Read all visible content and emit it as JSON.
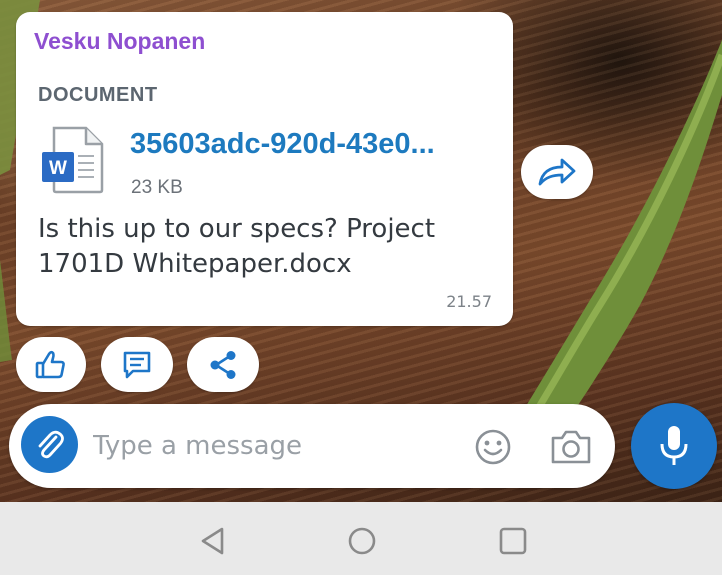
{
  "message": {
    "sender": "Vesku Nopanen",
    "attachment_type_label": "DOCUMENT",
    "file": {
      "name": "35603adc-920d-43e0...",
      "size": "23 KB",
      "icon": "word-document-icon",
      "icon_letter": "W"
    },
    "text": "Is this up to our specs?  Project 1701D Whitepaper.docx",
    "time": "21.57"
  },
  "actions": {
    "forward_icon": "forward-arrow-icon",
    "like_icon": "thumbs-up-icon",
    "reply_icon": "comment-icon",
    "share_icon": "share-icon"
  },
  "composer": {
    "placeholder": "Type a message",
    "value": "",
    "attach_icon": "paperclip-icon",
    "emoji_icon": "smiley-icon",
    "camera_icon": "camera-icon",
    "mic_icon": "microphone-icon"
  },
  "system_nav": {
    "back_icon": "back-triangle-icon",
    "home_icon": "home-circle-icon",
    "recents_icon": "recents-square-icon"
  },
  "colors": {
    "sender": "#8e4fd0",
    "link": "#1d7abf",
    "accent": "#1e76c8",
    "bubble": "#ffffff",
    "nav_bar": "#e9e9e9"
  }
}
